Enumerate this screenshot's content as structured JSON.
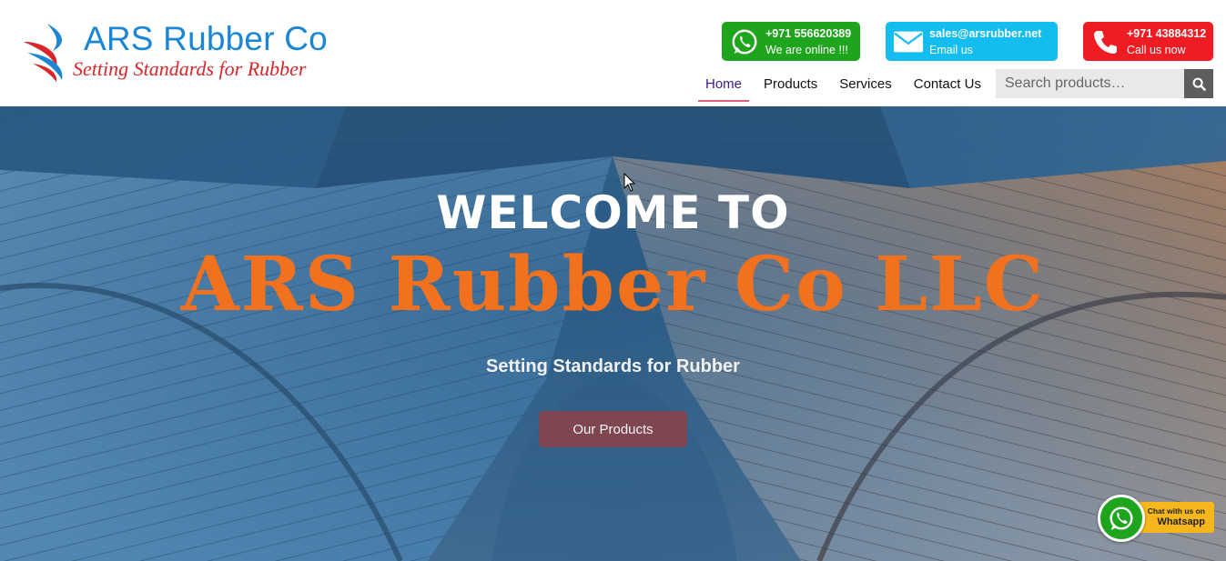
{
  "brand": {
    "name": "ARS Rubber Co",
    "tagline": "Setting Standards for Rubber",
    "colors": {
      "name": "#1b86d4",
      "tagline": "#d8262b"
    }
  },
  "contacts": {
    "whatsapp": {
      "line1": "+971 556620389",
      "line2": "We are online !!!",
      "icon": "whatsapp-icon",
      "color": "#1fa51d"
    },
    "email": {
      "line1": "sales@arsrubber.net",
      "line2": "Email us",
      "icon": "envelope-icon",
      "color": "#13bdf0"
    },
    "call": {
      "line1": "+971 43884312",
      "line2": "Call us now",
      "icon": "phone-icon",
      "color": "#ef1c24"
    }
  },
  "nav": {
    "items": [
      {
        "label": "Home",
        "active": true
      },
      {
        "label": "Products",
        "active": false
      },
      {
        "label": "Services",
        "active": false
      },
      {
        "label": "Contact Us",
        "active": false
      }
    ]
  },
  "search": {
    "placeholder": "Search products…",
    "icon": "search-icon"
  },
  "hero": {
    "welcome": "WELCOME TO",
    "company": "ARS Rubber Co LLC",
    "tagline": "Setting Standards for Rubber",
    "cta": "Our Products",
    "colors": {
      "company": "#f2711f",
      "cta": "#7f4652"
    }
  },
  "chat_widget": {
    "line1": "Chat with us on",
    "line2": "Whatsapp",
    "icon": "whatsapp-icon"
  }
}
